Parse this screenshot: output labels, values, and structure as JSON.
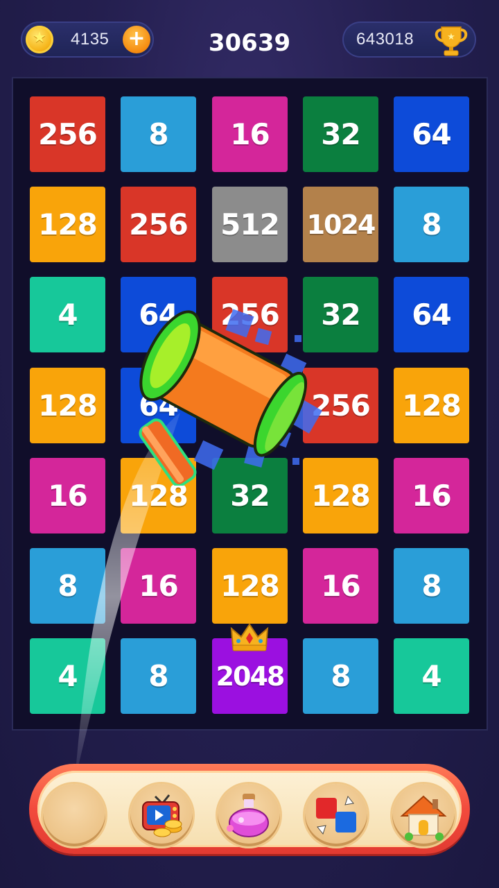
{
  "header": {
    "coins": "4135",
    "score": "30639",
    "best_score": "643018"
  },
  "board": {
    "rows": [
      [
        {
          "value": "256",
          "color": "#d93628"
        },
        {
          "value": "8",
          "color": "#2a9ed8"
        },
        {
          "value": "16",
          "color": "#d4269a"
        },
        {
          "value": "32",
          "color": "#0b7f3f"
        },
        {
          "value": "64",
          "color": "#0d4bd9"
        }
      ],
      [
        {
          "value": "128",
          "color": "#f9a40a"
        },
        {
          "value": "256",
          "color": "#d93628"
        },
        {
          "value": "512",
          "color": "#8c8c8c"
        },
        {
          "value": "1024",
          "color": "#b3814b"
        },
        {
          "value": "8",
          "color": "#2a9ed8"
        }
      ],
      [
        {
          "value": "4",
          "color": "#17c89a"
        },
        {
          "value": "64",
          "color": "#0d4bd9"
        },
        {
          "value": "256",
          "color": "#d93628"
        },
        {
          "value": "32",
          "color": "#0b7f3f"
        },
        {
          "value": "64",
          "color": "#0d4bd9"
        }
      ],
      [
        {
          "value": "128",
          "color": "#f9a40a"
        },
        {
          "value": "64",
          "color": "#0d4bd9"
        },
        {
          "value": "",
          "color": "#100e2a"
        },
        {
          "value": "256",
          "color": "#d93628"
        },
        {
          "value": "128",
          "color": "#f9a40a"
        }
      ],
      [
        {
          "value": "16",
          "color": "#d4269a"
        },
        {
          "value": "128",
          "color": "#f9a40a"
        },
        {
          "value": "32",
          "color": "#0b7f3f"
        },
        {
          "value": "128",
          "color": "#f9a40a"
        },
        {
          "value": "16",
          "color": "#d4269a"
        }
      ],
      [
        {
          "value": "8",
          "color": "#2a9ed8"
        },
        {
          "value": "16",
          "color": "#d4269a"
        },
        {
          "value": "128",
          "color": "#f9a40a"
        },
        {
          "value": "16",
          "color": "#d4269a"
        },
        {
          "value": "8",
          "color": "#2a9ed8"
        }
      ],
      [
        {
          "value": "4",
          "color": "#17c89a"
        },
        {
          "value": "8",
          "color": "#2a9ed8"
        },
        {
          "value": "2048",
          "color": "#9b10e0",
          "crown": true
        },
        {
          "value": "8",
          "color": "#2a9ed8"
        },
        {
          "value": "4",
          "color": "#17c89a"
        }
      ]
    ]
  },
  "toolbar": {
    "items": [
      {
        "name": "empty-slot",
        "icon": "empty"
      },
      {
        "name": "watch-video-coins-button",
        "icon": "tv-coins-icon"
      },
      {
        "name": "potion-button",
        "icon": "potion-icon"
      },
      {
        "name": "swap-blocks-button",
        "icon": "swap-blocks-icon"
      },
      {
        "name": "home-button",
        "icon": "home-icon"
      }
    ]
  },
  "colors": {
    "background": "#241f4f",
    "toolbar_frame": "#f24b3d",
    "toolbar_inner": "#fdf1d6"
  }
}
